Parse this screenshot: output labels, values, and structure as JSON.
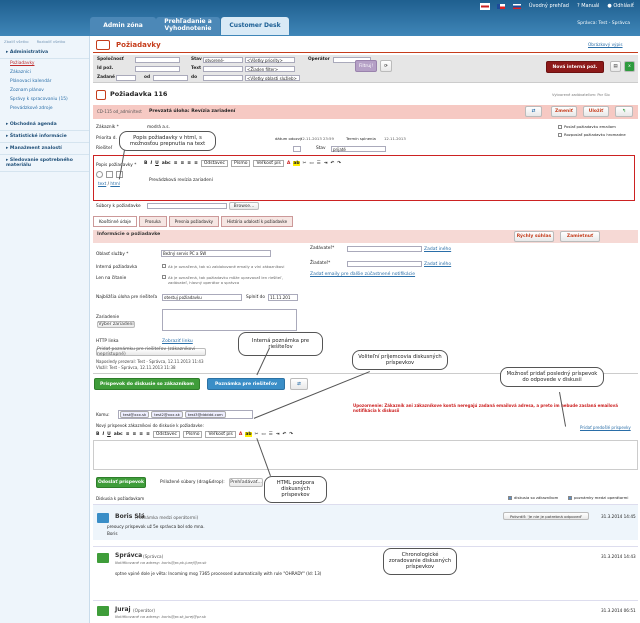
{
  "topnav": {
    "tabs": [
      "Admin zóna",
      "Prehľadanie a Vyhodnotenie",
      "Customer Desk"
    ],
    "links": [
      "Úvodný prehľad",
      "Manuál",
      "Odhlásiť"
    ],
    "user": "Správca: Test - Správca"
  },
  "sidebar": {
    "toplinks": [
      "Zbaliť všetko",
      "Rozbaliť všetko"
    ],
    "sections": [
      {
        "title": "Administratíva",
        "items": [
          "Požiadavky",
          "Zákazníci",
          "Plánovací kalendár",
          "Zoznam plánov",
          "Správy k spracovaniu (15)",
          "Prevádzkové zdroje"
        ]
      },
      {
        "title": "Obchodná agenda",
        "items": []
      },
      {
        "title": "Štatistické informácie",
        "items": []
      },
      {
        "title": "Manažment znalostí",
        "items": []
      },
      {
        "title": "Sledovanie spotrebného materiálu",
        "items": []
      }
    ]
  },
  "requests": {
    "title": "Požiadavky",
    "settings_link": "Obrázkový výpis",
    "filter": {
      "spolocnost": "Spoločnosť",
      "stav": "Stav",
      "stav_val": "otvorené-",
      "priority": "<Všetky priority>",
      "operator": "Operátor",
      "id": "Id pož.",
      "text": "Text",
      "riesitel": "<Žiaden filter>",
      "zadane": "Zadané",
      "od": "od",
      "do": "do",
      "sluzby": "<Všetky oblasti služieb>",
      "filter_btn": "Filtruj!",
      "new_btn": "Nová interná pož."
    }
  },
  "detail": {
    "title": "Požiadavka 116",
    "subtitle_right": "Vytvorené zadávateľom: Por Slo",
    "id_line": "CD-115 od_admin/test",
    "header_text": "Prevzatá úloha: Revízia zariadení",
    "btn_zmenit": "Zmeniť",
    "btn_ulozit": "Uložiť",
    "zakaznik_lbl": "Zákazník",
    "zakaznik_val": "modrá a.s.",
    "priorita_lbl": "Priorita d.",
    "datum_lbl": "dátum odozvy",
    "datum_val": "12.11.2013 23:59",
    "termin_lbl": "Termín splnenia",
    "termin_val": "12.11.2013",
    "chk1": "Poslať požiadavku emailom",
    "chk2": "Rozposlať požiadavku hromadne",
    "riesitel_lbl": "Riešiteľ",
    "stav_lbl": "Stav",
    "stav_val": "prijaté",
    "popis_lbl": "Popis požiadavky",
    "popis_text": "Prevádzková revízia zariadení",
    "text_link": "text",
    "html_link": "html",
    "odstavec": "Odstavec",
    "pismo": "Písmo",
    "velkost": "Veľkosť pís",
    "subory_lbl": "Súbory k požiadavke",
    "prehladat": "Browse...",
    "tabs": [
      "Kooštinné údaje",
      "Prosuka",
      "Presnia požiadavky",
      "História udalostí k požiadavke"
    ],
    "info_bar": "Informácie o požiadavke",
    "rychly": "Rýchly súhlas",
    "zamietnut": "Zamietnuť",
    "oblast_lbl": "Oblasť služby",
    "oblast_val": "Bežný servis PC a SW",
    "zadavatel_lbl": "Zadávateľ",
    "zadat_ineho": "Zadať iného",
    "ziadatel_lbl": "Žiadateľ",
    "emaily_link": "Zadať emaily pre ďalšie zúčastnené notifikácie",
    "interna_lbl": "Interná požiadavka",
    "interna_txt": "Ak je označená, tak sú zablokované emaily a víni zákazníkovi",
    "len_lbl": "Len na čítanie",
    "len_txt": "Ak je označená, tak požiadavku môže upravovať len riešiteľ, zadávateľ, hlavný operátor a správca",
    "najblizsia_lbl": "Najbližšia úloha pre riešiteľa",
    "najblizsia_val": "otestuj požiadavku",
    "splnit_lbl": "Splniť do",
    "splnit_val": "11.11.201",
    "zariadenie_lbl": "Zariadenie",
    "vyber_zar": "Výber zariadení",
    "http_lbl": "HTTP linka",
    "zobrazit": "Zobraziť linku",
    "pridat_poznamku": "Pridať poznámku pre riešiteľov (zákazníkovi neprístupné)",
    "naposledy": "Naposledy prezeral: Test - Správca, 12.11.2013 11:43",
    "vlozil": "Vložil: Test - Správca, 12.11.2013 11:38",
    "btn_diskusia": "Príspevok do diskusie so zákazníkom",
    "btn_poznamka": "Poznámka pre riešiteľov",
    "warning": "Upozornenie: Zákazník ani zákazníkove kontá neregajú zadaná emailová adresa, a preto im nebude zaslaná emailová notifikácia k diskusii",
    "komu_lbl": "Komu:",
    "emails": [
      "test@xxx.sk",
      "test2@xxx.sk",
      "test3@ddddd.com"
    ],
    "novy_lbl": "Nový príspevok zákazníkovi do diskusie k požiadavke:",
    "pridat_post_link": "Pridať predošlé príspevky",
    "odoslat": "Odoslať príspevok",
    "prilozene": "Priložené súbory (drag&drop):",
    "prehladavat": "Prehľadávať...",
    "diskusia_lbl": "Diskusia k požiadavkam",
    "chk_diskusia": "diskusia so zákazníkom",
    "chk_poznamky": "poznámky medzi operátormi"
  },
  "posts": [
    {
      "name": "Boris Slá",
      "role": "(Poznámka medzi operátormi)",
      "text": "preoucy príspevok už 5e    správca bol sdo mna.",
      "text2": "Boris",
      "action": "Potvrdiť: 'Je nie je potrebná odpoveď'",
      "date": "31.3.2014 14:45"
    },
    {
      "name": "Správca",
      "role": "(Správca)",
      "meta": "Notifikované na adresy: boris@pr.pk.jurej@pr.sk",
      "text": "sptne vpiné dole je věta: Incoming msg 7365 processed automatically with rule \"OHRADY\" (Id: 13)",
      "date": "31.3.2014 14:43"
    },
    {
      "name": "Juraj",
      "role": "(Operátor)",
      "meta": "Notifikované na adresy: boris@pr.sk,jurej@pr.sk",
      "date": "31.3.2014 06:51"
    }
  ],
  "callouts": {
    "c1": "Popis požiadavky v html, s možnosťou prepnutia na text",
    "c2": "Interná poznámka pre riešiteľov",
    "c3": "Voliteľní príjemcovia diskusných príspevkov",
    "c4": "Možnosť pridať posledný príspevok do odpovede v diskusii",
    "c5": "HTML podpora diskusných príspevkov",
    "c6": "Chronologické zoradovanie diskusných príspevkov"
  }
}
